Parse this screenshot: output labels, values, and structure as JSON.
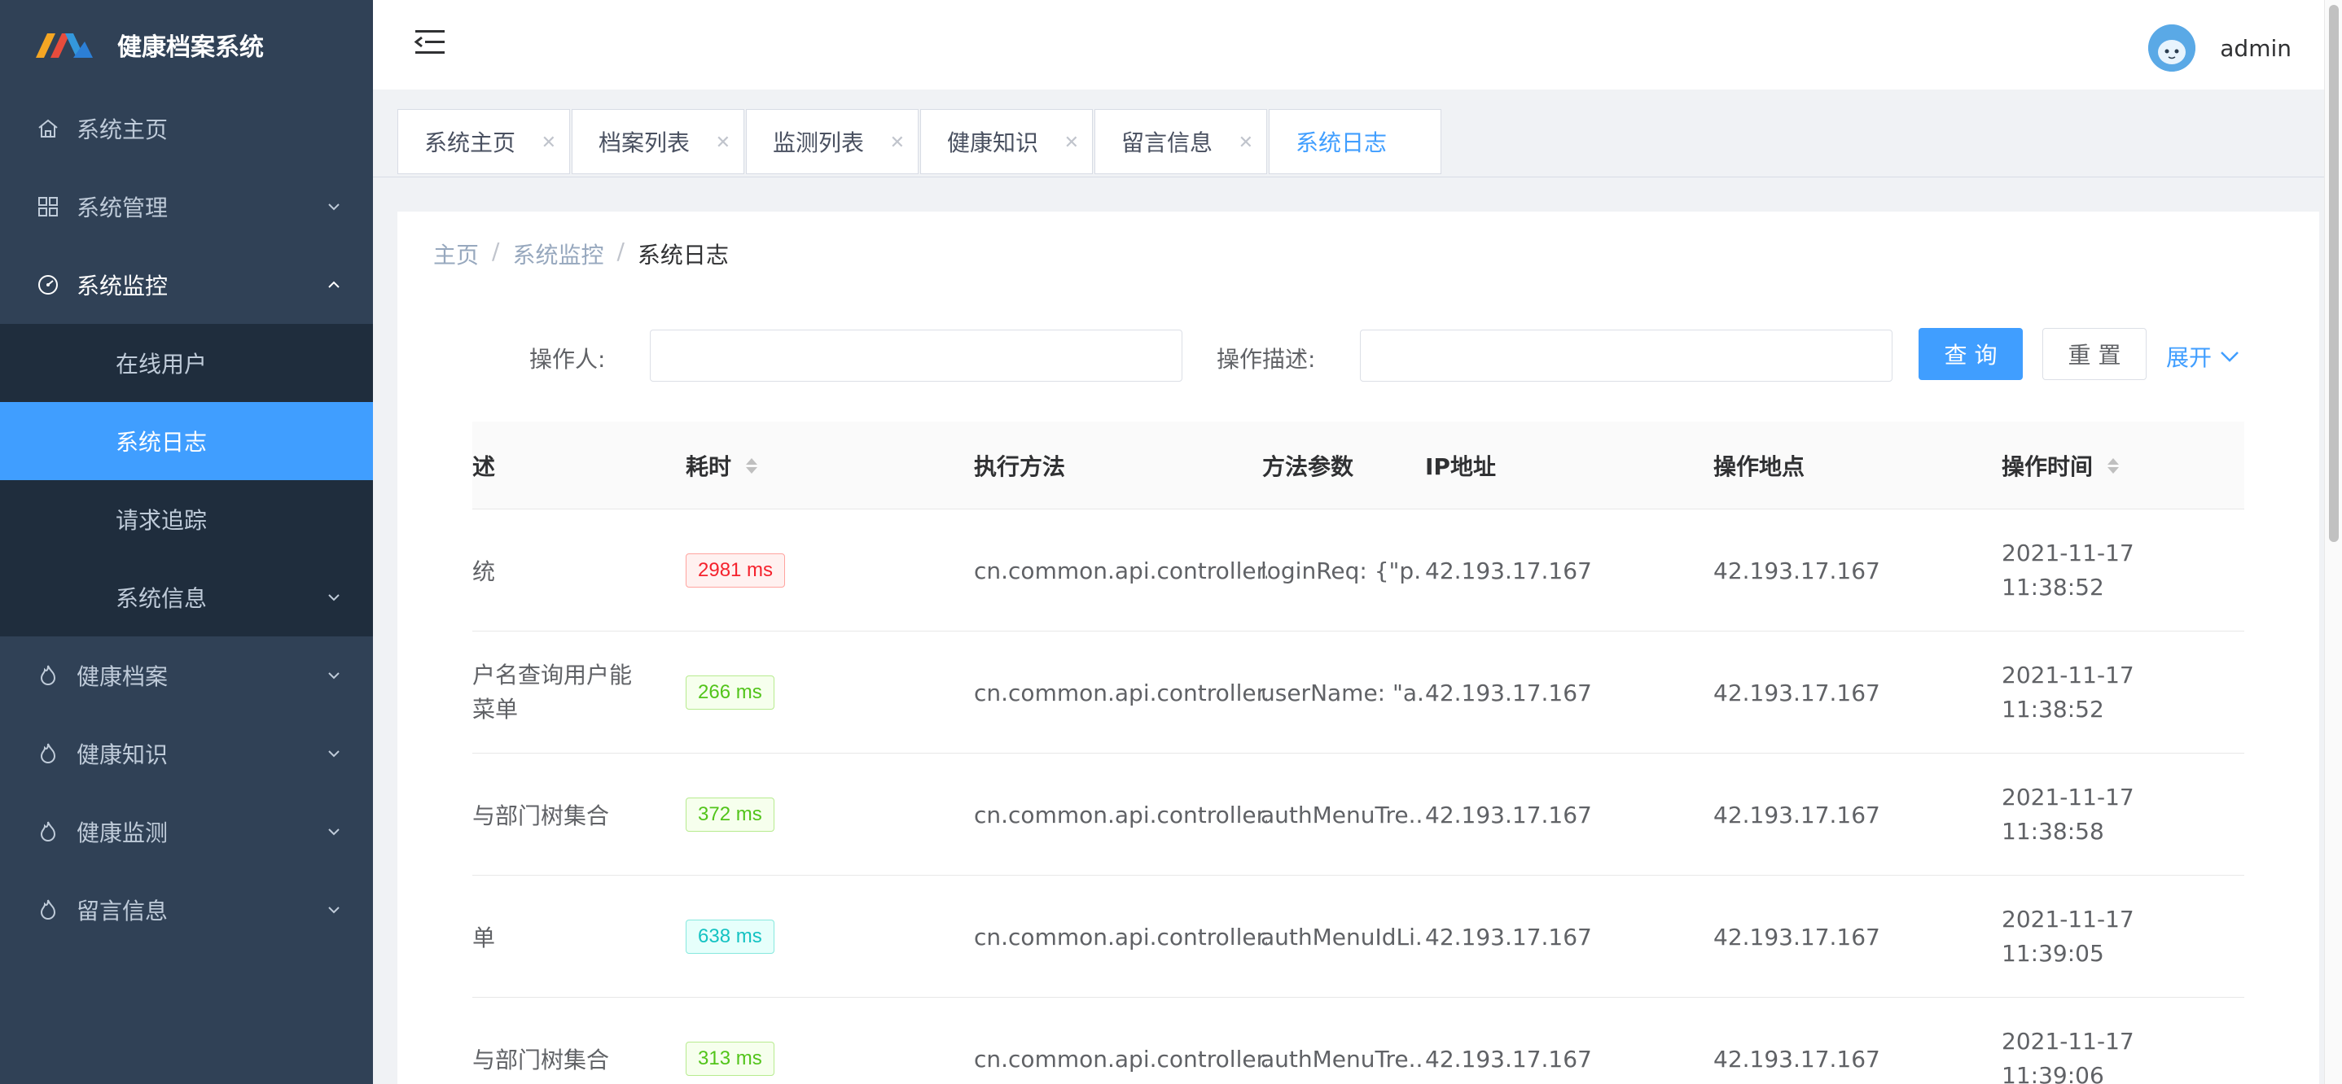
{
  "app": {
    "title": "健康档案系统"
  },
  "sidebar": {
    "items": [
      {
        "label": "系统主页",
        "icon": "home-icon"
      },
      {
        "label": "系统管理",
        "icon": "grid-icon"
      },
      {
        "label": "系统监控",
        "icon": "dashboard-icon",
        "expanded": true,
        "children": [
          {
            "label": "在线用户"
          },
          {
            "label": "系统日志",
            "active": true
          },
          {
            "label": "请求追踪"
          },
          {
            "label": "系统信息"
          }
        ]
      },
      {
        "label": "健康档案",
        "icon": "flame-icon"
      },
      {
        "label": "健康知识",
        "icon": "flame-icon"
      },
      {
        "label": "健康监测",
        "icon": "flame-icon"
      },
      {
        "label": "留言信息",
        "icon": "flame-icon"
      }
    ]
  },
  "header": {
    "username": "admin"
  },
  "tabs": [
    {
      "label": "系统主页"
    },
    {
      "label": "档案列表"
    },
    {
      "label": "监测列表"
    },
    {
      "label": "健康知识"
    },
    {
      "label": "留言信息"
    },
    {
      "label": "系统日志",
      "active": true
    }
  ],
  "breadcrumb": [
    "主页",
    "系统监控",
    "系统日志"
  ],
  "search": {
    "operator_label": "操作人:",
    "operator_value": "",
    "desc_label": "操作描述:",
    "desc_value": "",
    "query_label": "查 询",
    "reset_label": "重 置",
    "expand_label": "展开"
  },
  "table": {
    "columns": [
      "述",
      "耗时",
      "执行方法",
      "方法参数",
      "IP地址",
      "操作地点",
      "操作时间"
    ],
    "rows": [
      {
        "desc": "统",
        "time": "2981 ms",
        "level": "red",
        "method": "cn.common.api.controller.Au",
        "params": "loginReq: {\"p...",
        "ip": "42.193.17.167",
        "location": "42.193.17.167",
        "date": "2021-11-17",
        "clock": "11:38:52"
      },
      {
        "desc": "户名查询用户能菜单",
        "time": "266 ms",
        "level": "green",
        "method": "cn.common.api.controller.Au",
        "params": "userName: \"a...",
        "ip": "42.193.17.167",
        "location": "42.193.17.167",
        "date": "2021-11-17",
        "clock": "11:38:52"
      },
      {
        "desc": "与部门树集合",
        "time": "372 ms",
        "level": "green",
        "method": "cn.common.api.controller.Au",
        "params": "authMenuTre...",
        "ip": "42.193.17.167",
        "location": "42.193.17.167",
        "date": "2021-11-17",
        "clock": "11:38:58"
      },
      {
        "desc": "单",
        "time": "638 ms",
        "level": "cyan",
        "method": "cn.common.api.controller.Au",
        "params": "authMenuIdLi...",
        "ip": "42.193.17.167",
        "location": "42.193.17.167",
        "date": "2021-11-17",
        "clock": "11:39:05"
      },
      {
        "desc": "与部门树集合",
        "time": "313 ms",
        "level": "green",
        "method": "cn.common.api.controller.Au",
        "params": "authMenuTre...",
        "ip": "42.193.17.167",
        "location": "42.193.17.167",
        "date": "2021-11-17",
        "clock": "11:39:06"
      }
    ]
  },
  "colors": {
    "sidebar": "#304156",
    "accent": "#409eff",
    "red": "#f5222d",
    "green": "#52c41a",
    "cyan": "#13c2c2"
  }
}
